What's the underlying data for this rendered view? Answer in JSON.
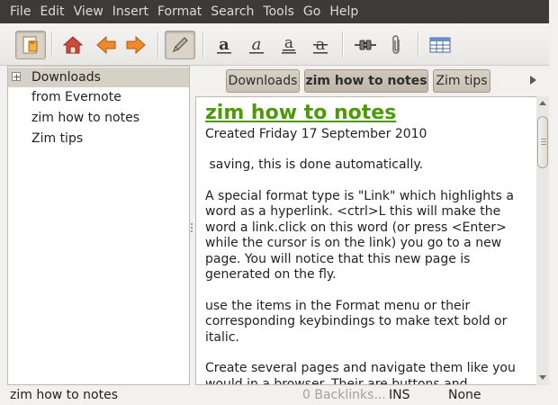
{
  "menubar": {
    "items": [
      "File",
      "Edit",
      "View",
      "Insert",
      "Format",
      "Search",
      "Tools",
      "Go",
      "Help"
    ]
  },
  "toolbar": {
    "buttons": [
      {
        "icon": "index-page-icon",
        "pressed": true
      },
      {
        "icon": "home-icon"
      },
      {
        "icon": "back-arrow-icon"
      },
      {
        "icon": "forward-arrow-icon"
      },
      {
        "icon": "edit-pencil-icon",
        "pressed": true
      },
      {
        "icon": "bold-icon"
      },
      {
        "icon": "italic-icon"
      },
      {
        "icon": "underline-icon"
      },
      {
        "icon": "strikethrough-icon"
      },
      {
        "icon": "insert-link-icon"
      },
      {
        "icon": "attach-file-icon"
      },
      {
        "icon": "insert-table-icon"
      }
    ],
    "colors": {
      "accent_orange": "#e2741c",
      "home_red": "#c9423a"
    }
  },
  "tree": {
    "items": [
      {
        "label": "Downloads",
        "expander": "+",
        "selected": true
      },
      {
        "label": "from Evernote"
      },
      {
        "label": "zim how to notes"
      },
      {
        "label": "Zim tips"
      }
    ]
  },
  "tabs": [
    {
      "label": "Downloads"
    },
    {
      "label": "zim how to notes",
      "active": true
    },
    {
      "label": "Zim tips"
    }
  ],
  "editor": {
    "title": "zim how to notes",
    "title_color": "#4e9a06",
    "created": "Created Friday 17 September 2010",
    "paragraphs": [
      " saving, this is done automatically.",
      "A special format type is \"Link\" which highlights a word as a hyperlink. <ctrl>L this will make the word a link.click on this word (or press <Enter> while the cursor is on the link) you go to a new page. You will notice that this new page is generated on the fly.",
      "use the items in the Format menu or their corresponding keybindings to make text bold or italic.",
      "Create several pages and navigate them like you would in a browser. Their are buttons and keybindings for going Back, Forward or Home."
    ]
  },
  "statusbar": {
    "page": "zim how to notes",
    "backlinks": "0 Backlinks...",
    "mode": "INS",
    "style": "None"
  }
}
